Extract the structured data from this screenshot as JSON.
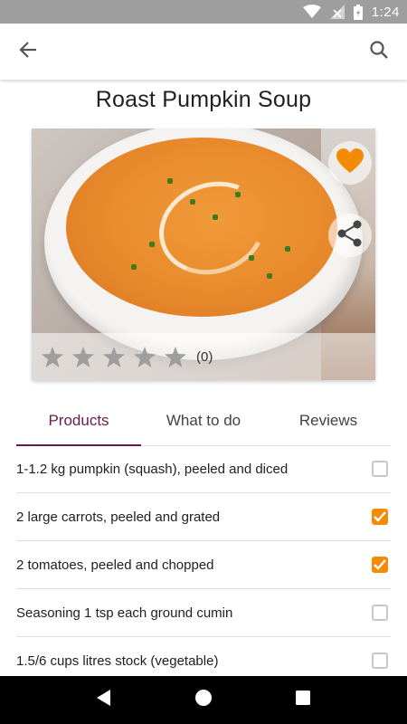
{
  "status_bar": {
    "time": "1:24",
    "icons": [
      "wifi-icon",
      "signal-icon",
      "battery-icon"
    ]
  },
  "app_bar": {
    "back_icon": "arrow-left-icon",
    "search_icon": "search-icon"
  },
  "recipe": {
    "title": "Roast Pumpkin Soup",
    "rating": 0,
    "rating_max": 5,
    "rating_count": "(0)",
    "favorite_icon": "heart-icon",
    "share_icon": "share-icon"
  },
  "tabs": [
    {
      "label": "Products",
      "active": true
    },
    {
      "label": "What to do",
      "active": false
    },
    {
      "label": "Reviews",
      "active": false
    }
  ],
  "ingredients": [
    {
      "text": "1-1.2 kg pumpkin (squash), peeled and diced",
      "checked": false
    },
    {
      "text": "2 large carrots, peeled and grated",
      "checked": true
    },
    {
      "text": "2 tomatoes, peeled and chopped",
      "checked": true
    },
    {
      "text": "Seasoning 1 tsp each ground cumin",
      "checked": false
    },
    {
      "text": "1.5/6 cups litres stock (vegetable)",
      "checked": false
    }
  ],
  "nav_bar": {
    "icons": [
      "back-triangle-icon",
      "home-circle-icon",
      "recents-square-icon"
    ]
  },
  "colors": {
    "accent": "#6a1b4d",
    "orange": "#f58a07",
    "status_bar": "#9e9e9e"
  }
}
